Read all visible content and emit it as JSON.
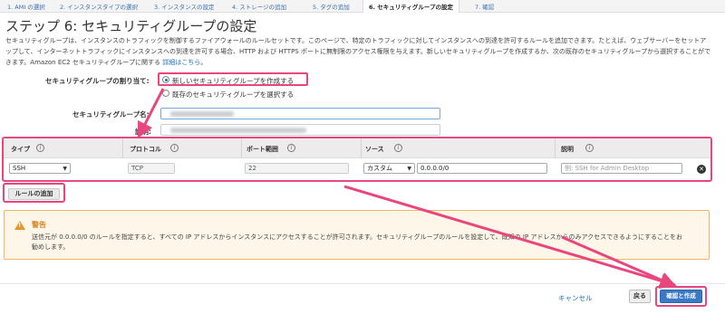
{
  "wizard": {
    "tabs": [
      "1. AMI の選択",
      "2. インスタンスタイプの選択",
      "3. インスタンスの設定",
      "4. ストレージの追加",
      "5. タグの追加",
      "6. セキュリティグループの設定",
      "7. 確認"
    ],
    "active_tab": 5
  },
  "page": {
    "title": "ステップ 6: セキュリティグループの設定",
    "description": "セキュリティグループは、インスタンスのトラフィックを制御するファイアウォールのルールセットです。このページで、特定のトラフィックに対してインスタンスへの到達を許可するルールを追加できます。たとえば、ウェブサーバーをセットアップして、インターネットトラフィックにインスタンスへの到達を許可する場合、HTTP および HTTPS ポートに無制限のアクセス権限を与えます。新しいセキュリティグループを作成するか、次の既存のセキュリティグループから選択することができます。Amazon EC2 セキュリティグループに関する",
    "learn_more": "詳細はこちら",
    "learn_more_suffix": "。"
  },
  "assign": {
    "label": "セキュリティグループの割り当て:",
    "option_new": "新しいセキュリティグループを作成する",
    "option_existing": "既存のセキュリティグループを選択する",
    "selected": "new"
  },
  "form": {
    "name_label": "セキュリティグループ名:",
    "desc_label": "説明:"
  },
  "rules": {
    "headers": [
      "タイプ",
      "プロトコル",
      "ポート範囲",
      "ソース",
      "説明"
    ],
    "row": {
      "type": "SSH",
      "protocol": "TCP",
      "port": "22",
      "source_mode": "カスタム",
      "source_cidr": "0.0.0.0/0",
      "description_placeholder": "例: SSH for Admin Desktop"
    },
    "add_rule": "ルールの追加"
  },
  "warning": {
    "title": "警告",
    "body": "送信元が 0.0.0.0/0 のルールを指定すると、すべての IP アドレスからインスタンスにアクセスすることが許可されます。セキュリティグループのルールを設定して、既知の IP アドレスからのみアクセスできるようにすることをお勧めします。"
  },
  "footer": {
    "cancel": "キャンセル",
    "back": "戻る",
    "review_launch": "確認と作成"
  },
  "colors": {
    "highlight": "#e8467c",
    "link": "#1a6fc2",
    "primary_button": "#3b79c5",
    "warning_accent": "#e9952d"
  }
}
